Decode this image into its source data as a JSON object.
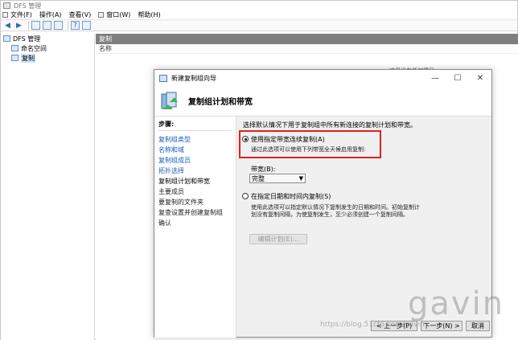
{
  "window": {
    "title": "DFS 管理"
  },
  "menu": [
    "文件(F)",
    "操作(A)",
    "查看(V)",
    "窗口(W)",
    "帮助(H)"
  ],
  "tree": {
    "root": "DFS 管理",
    "children": [
      "命名空间",
      "复制"
    ]
  },
  "right_pane": {
    "header": "复制",
    "column": "名称",
    "background_note": "这里没有任何项目"
  },
  "dialog": {
    "title": "新建复制组向导",
    "heading": "复制组计划和带宽",
    "steps_header": "步骤:",
    "steps": [
      "复制组类型",
      "名称和域",
      "复制组成员",
      "拓扑选择",
      "复制组计划和带宽",
      "主要成员",
      "要复制的文件夹",
      "复查设置并创建复制组",
      "确认"
    ],
    "intro": "选择默认情况下用于复制组中所有新连接的复制计划和带宽。",
    "option1": {
      "label": "使用指定带宽连续复制(A)",
      "desc": "通过此选项可以使用下列带宽全天候启用复制:"
    },
    "bandwidth_label": "带宽(B):",
    "bandwidth_value": "完整",
    "option2": {
      "label": "在指定日期和时间内复制(S)",
      "desc1": "使用此选项可以指定默认情况下复制发生的日期和时间。初始复制计",
      "desc2": "划没有复制间隔，为使复制发生，至少必须创建一个复制间隔。"
    },
    "edit_schedule_btn": "编辑计划(E)...",
    "back_btn": "< 上一步(P)",
    "next_btn": "下一步(N) >",
    "cancel_btn": "取消"
  },
  "watermark": {
    "big": "gavin",
    "small": "https://blog.51cto.com/gavin"
  }
}
